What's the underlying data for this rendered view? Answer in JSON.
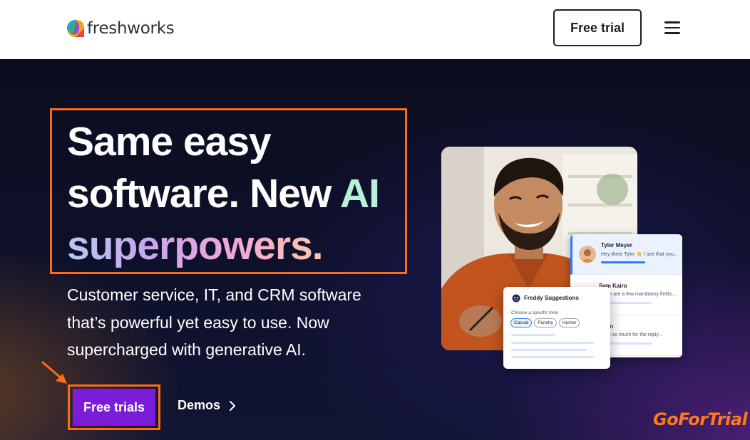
{
  "header": {
    "logo_text": "freshworks",
    "free_trial_label": "Free trial",
    "menu_icon": "hamburger-menu-icon"
  },
  "hero": {
    "headline_part1": "Same easy software. New ",
    "headline_ai": "AI",
    "headline_part2": "superpowers.",
    "subtext": "Customer service, IT, and CRM software that’s powerful yet easy to use. Now supercharged with generative AI.",
    "primary_cta": "Free trials",
    "secondary_cta": "Demos"
  },
  "mockup": {
    "chat_list": [
      {
        "name": "Tyler Meyer",
        "message": "Hey there Tyler 👋 I see that you..."
      },
      {
        "name": "Sam Kairo",
        "message": "There are a few mandatory fields..."
      },
      {
        "name": "Chen",
        "message": "k you so much for the reply..."
      }
    ],
    "freddy": {
      "title": "Freddy Suggestions",
      "label": "Choose a specific tone",
      "tones": [
        "Casual",
        "Punchy",
        "Humor"
      ]
    }
  },
  "watermark": "GoForTrial",
  "colors": {
    "accent_orange": "#ff6a13",
    "cta_purple": "#7a1cd8",
    "hero_bg": "#0b0d1f",
    "ai_text": "#b8f0d9"
  }
}
